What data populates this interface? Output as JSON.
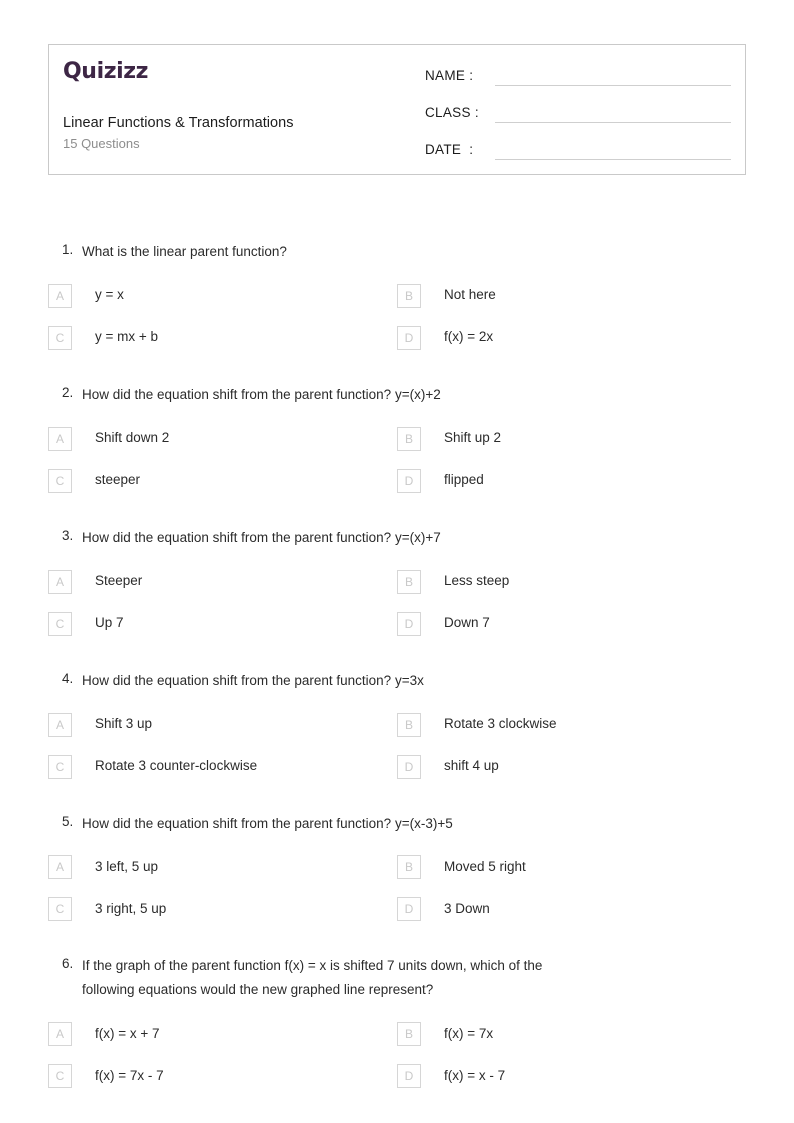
{
  "header": {
    "brand": "Quizizz",
    "brand_color": "#3d2645",
    "title": "Linear Functions & Transformations",
    "subtitle": "15 Questions",
    "fields": [
      {
        "label": "NAME :",
        "value": ""
      },
      {
        "label": "CLASS :",
        "value": ""
      },
      {
        "label": "DATE  :",
        "value": ""
      }
    ]
  },
  "option_letters": [
    "A",
    "B",
    "C",
    "D"
  ],
  "questions": [
    {
      "number": "1.",
      "text": "What is the linear parent function?",
      "options": [
        "y = x",
        "Not here",
        "y = mx + b",
        "f(x) = 2x"
      ]
    },
    {
      "number": "2.",
      "text": "How did the equation shift from the parent function? y=(x)+2",
      "options": [
        "Shift down 2",
        "Shift up 2",
        "steeper",
        "flipped"
      ]
    },
    {
      "number": "3.",
      "text": "How did the equation shift from the parent function? y=(x)+7",
      "options": [
        "Steeper",
        "Less steep",
        "Up 7",
        "Down 7"
      ]
    },
    {
      "number": "4.",
      "text": "How did the equation shift from the parent function? y=3x",
      "options": [
        "Shift 3 up",
        "Rotate 3 clockwise",
        "Rotate 3 counter-clockwise",
        "shift 4 up"
      ]
    },
    {
      "number": "5.",
      "text": "How did the equation shift from the parent function? y=(x-3)+5",
      "options": [
        "3 left, 5 up",
        "Moved 5 right",
        "3 right, 5 up",
        "3 Down"
      ]
    },
    {
      "number": "6.",
      "text": "If the graph of the parent function f(x) = x is shifted 7 units down, which of the following equations would the new graphed line represent?",
      "options": [
        "f(x) = x + 7",
        "f(x) = 7x",
        "f(x) = 7x - 7",
        "f(x) = x - 7"
      ]
    }
  ]
}
